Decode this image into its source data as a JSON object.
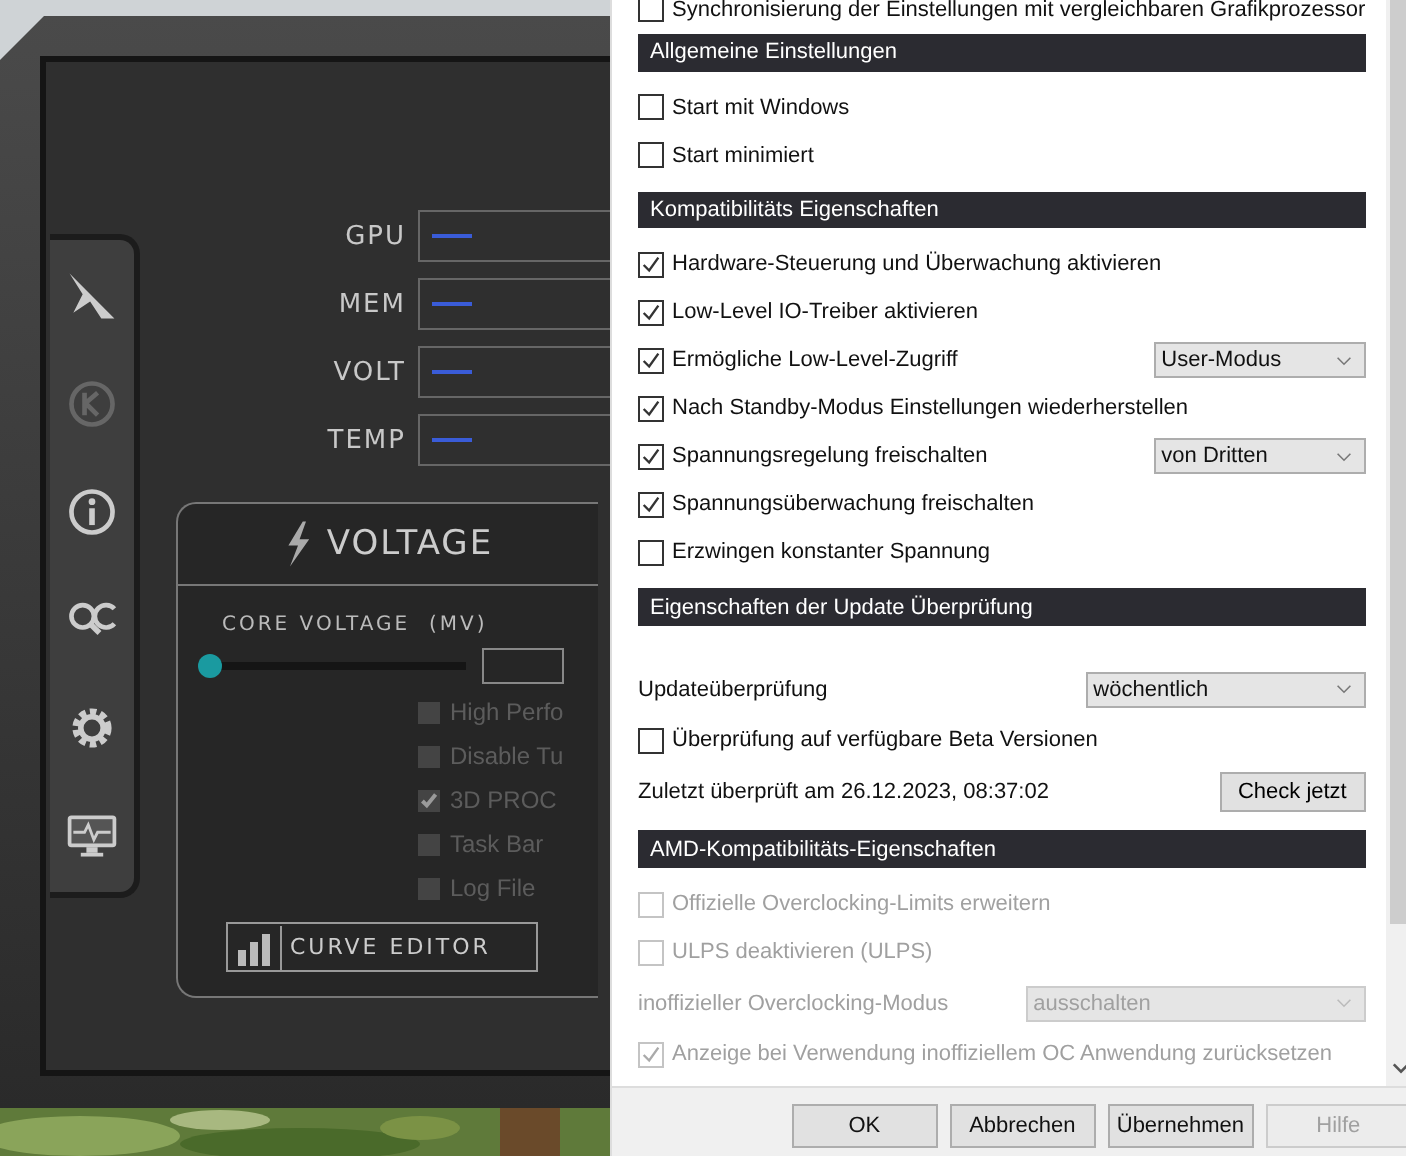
{
  "background_app": {
    "meters": [
      {
        "label": "GPU"
      },
      {
        "label": "MEM"
      },
      {
        "label": "VOLT"
      },
      {
        "label": "TEMP"
      }
    ],
    "options": [
      {
        "label": "High Perfo",
        "checked": false
      },
      {
        "label": "Disable Tu",
        "checked": false
      },
      {
        "label": "3D PROC",
        "checked": true
      },
      {
        "label": "Task Bar",
        "checked": false
      },
      {
        "label": "Log File",
        "checked": false
      }
    ],
    "voltage_panel": {
      "title": "VOLTAGE",
      "slider_label": "CORE VOLTAGE  (MV)",
      "level": 0,
      "button": "CURVE EDITOR"
    }
  },
  "settings": {
    "top_row": {
      "label": "Synchronisierung der Einstellungen mit vergleichbaren Grafikprozessor",
      "checked": false
    },
    "sections": [
      {
        "title": "Allgemeine Einstellungen",
        "rows": [
          {
            "kind": "checkbox",
            "label": "Start mit Windows",
            "checked": false,
            "disabled": false
          },
          {
            "kind": "checkbox",
            "label": "Start minimiert",
            "checked": false,
            "disabled": false
          }
        ]
      },
      {
        "title": "Kompatibilitäts Eigenschaften",
        "rows": [
          {
            "kind": "checkbox",
            "label": "Hardware-Steuerung und Überwachung aktivieren",
            "checked": true,
            "disabled": false
          },
          {
            "kind": "checkbox",
            "label": "Low-Level IO-Treiber aktivieren",
            "checked": true,
            "disabled": false
          },
          {
            "kind": "checkbox",
            "label": "Ermögliche Low-Level-Zugriff",
            "checked": true,
            "disabled": false,
            "value": "User-Modus"
          },
          {
            "kind": "checkbox",
            "label": "Nach Standby-Modus Einstellungen wiederherstellen",
            "checked": true,
            "disabled": false
          },
          {
            "kind": "checkbox",
            "label": "Spannungsregelung freischalten",
            "checked": true,
            "disabled": false,
            "value": "von Dritten"
          },
          {
            "kind": "checkbox",
            "label": "Spannungsüberwachung freischalten",
            "checked": true,
            "disabled": false
          },
          {
            "kind": "checkbox",
            "label": "Erzwingen konstanter Spannung",
            "checked": false,
            "disabled": false
          }
        ]
      },
      {
        "title": "Eigenschaften der Update Überprüfung",
        "rows": [
          {
            "kind": "select",
            "label": "Updateüberprüfung",
            "value": "wöchentlich",
            "disabled": false
          },
          {
            "kind": "checkbox",
            "label": "Überprüfung auf verfügbare Beta Versionen",
            "checked": false,
            "disabled": false
          },
          {
            "kind": "text_button",
            "label": "Zuletzt überprüft am 26.12.2023, 08:37:02",
            "button": "Check jetzt"
          }
        ]
      },
      {
        "title": "AMD-Kompatibilitäts-Eigenschaften",
        "rows": [
          {
            "kind": "checkbox",
            "label": "Offizielle Overclocking-Limits erweitern",
            "checked": false,
            "disabled": true
          },
          {
            "kind": "checkbox",
            "label": "ULPS deaktivieren (ULPS)",
            "checked": false,
            "disabled": true
          },
          {
            "kind": "select",
            "label": "inoffizieller Overclocking-Modus",
            "value": "ausschalten",
            "disabled": true
          },
          {
            "kind": "checkbox",
            "label": "Anzeige bei Verwendung inoffiziellem OC Anwendung zurücksetzen",
            "checked": true,
            "disabled": true
          }
        ]
      }
    ]
  },
  "buttons": [
    {
      "label": "OK",
      "disabled": false
    },
    {
      "label": "Abbrechen",
      "disabled": false
    },
    {
      "label": "Übernehmen",
      "disabled": false
    },
    {
      "label": "Hilfe",
      "disabled": true
    }
  ]
}
